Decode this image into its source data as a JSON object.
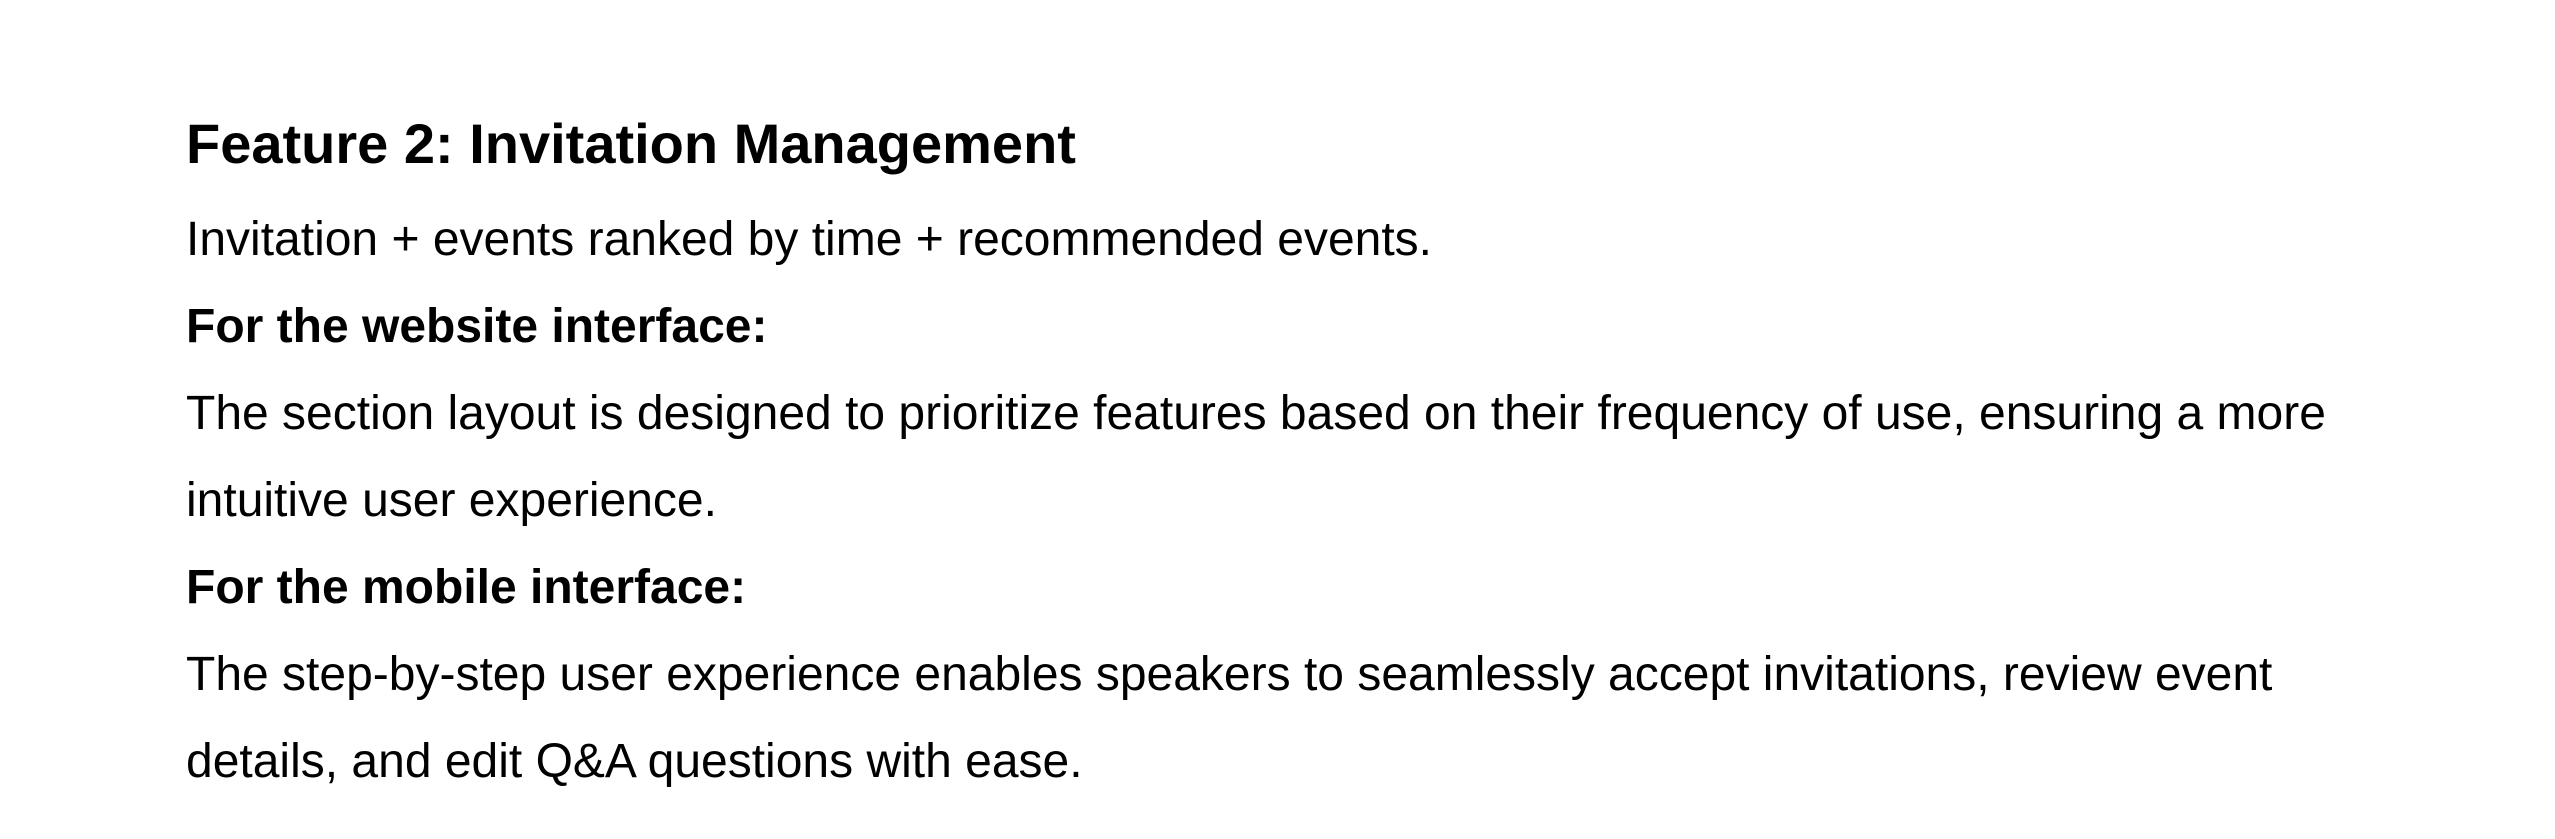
{
  "document": {
    "heading": "Feature 2: Invitation Management",
    "summary": "Invitation + events ranked by time + recommended events.",
    "website": {
      "label": "For the website interface:",
      "text": "The section layout is designed to prioritize features based on their frequency of use, ensuring a more intuitive user experience."
    },
    "mobile": {
      "label": "For the mobile interface:",
      "text": "The step-by-step user experience enables speakers to seamlessly accept invitations, review event details, and edit Q&A questions with ease."
    }
  }
}
